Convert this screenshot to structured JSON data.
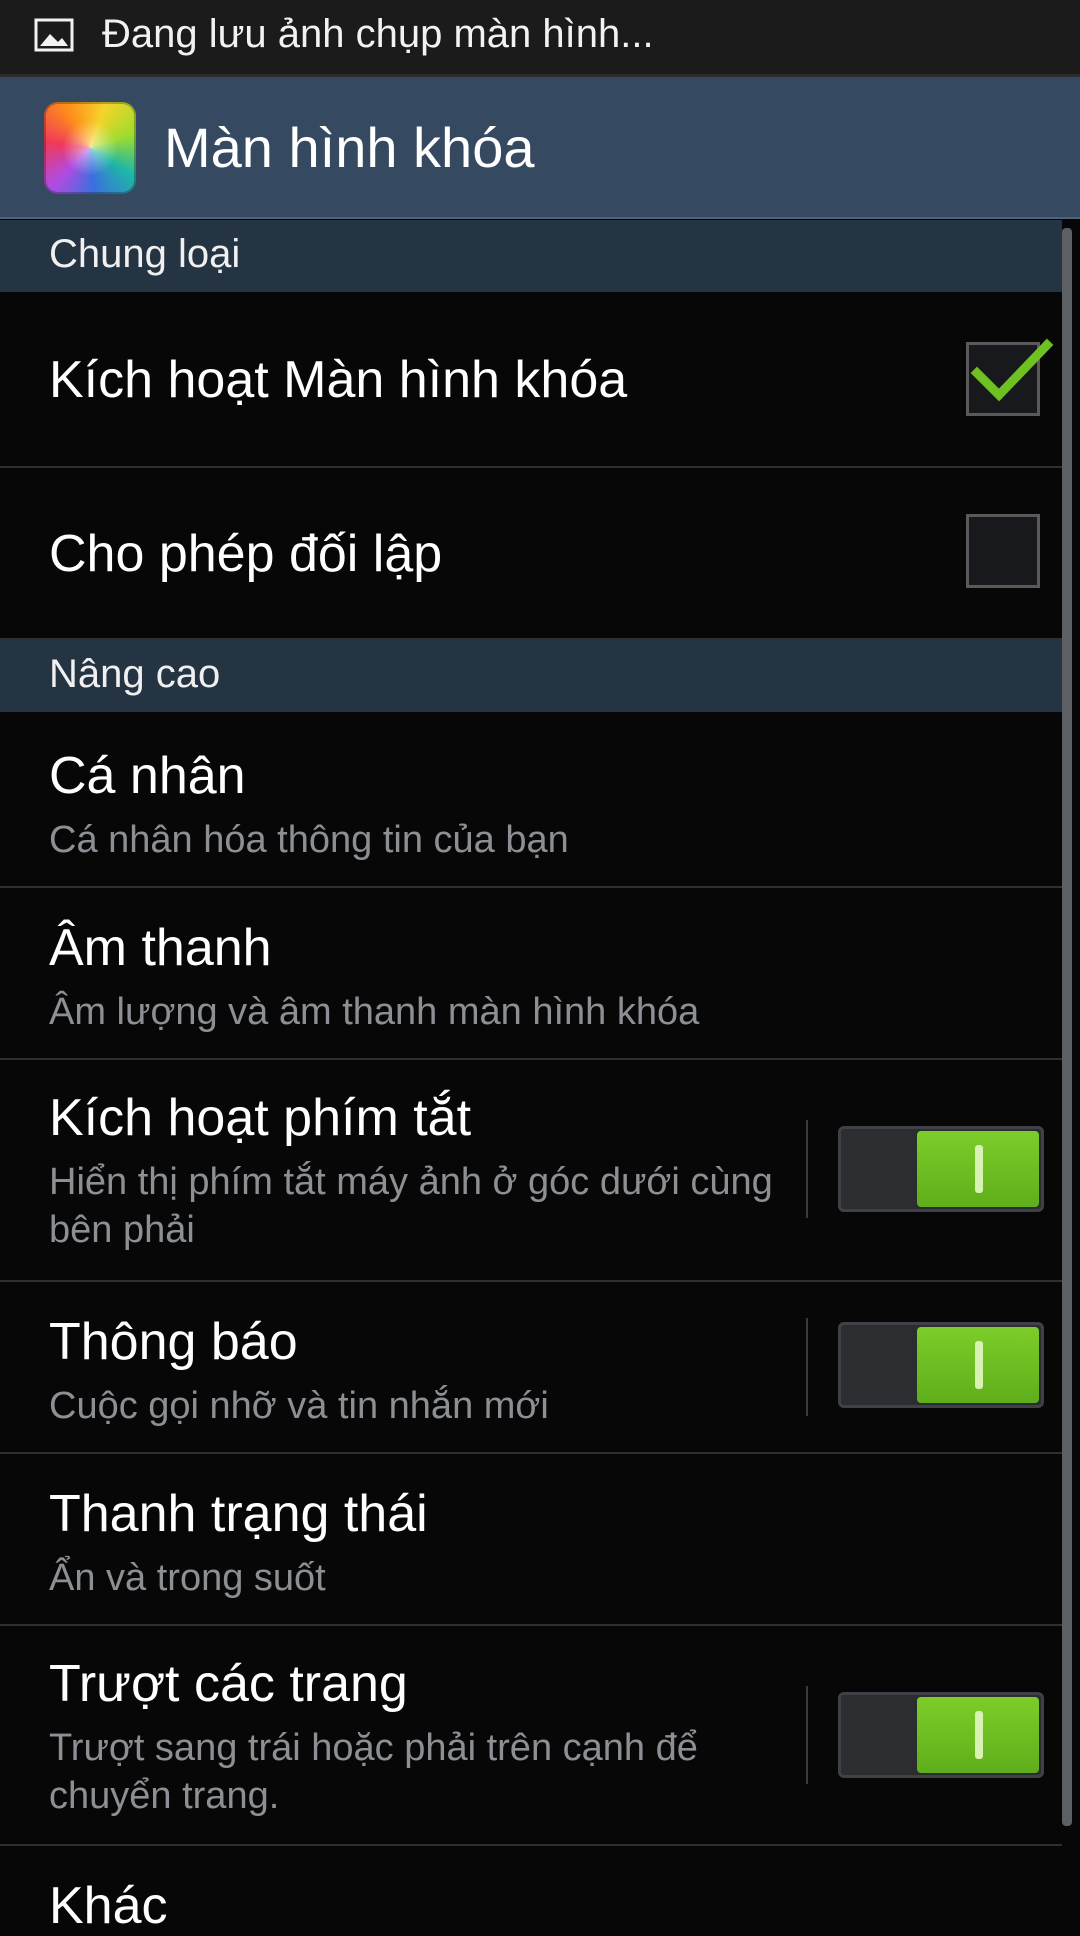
{
  "status_bar": {
    "icon": "image-icon",
    "text": "Đang lưu ảnh chụp màn hình..."
  },
  "action_bar": {
    "app_icon": "lock-screen-app-icon",
    "title": "Màn hình khóa"
  },
  "sections": {
    "general": {
      "label": "Chung loại"
    },
    "advanced": {
      "label": "Nâng cao"
    }
  },
  "items": {
    "enable_lock": {
      "title": "Kích hoạt Màn hình khóa",
      "checked": true
    },
    "allow_opposite": {
      "title": "Cho phép đối lập",
      "checked": false
    },
    "personal": {
      "title": "Cá nhân",
      "subtitle": "Cá nhân hóa thông tin của bạn"
    },
    "sound": {
      "title": "Âm thanh",
      "subtitle": "Âm lượng và âm thanh màn hình khóa"
    },
    "shortcut": {
      "title": "Kích hoạt phím tắt",
      "subtitle": "Hiển thị phím tắt máy ảnh ở góc dưới cùng bên phải",
      "on": true
    },
    "notifications": {
      "title": "Thông báo",
      "subtitle": "Cuộc gọi nhỡ và tin nhắn mới",
      "on": true
    },
    "status_bar": {
      "title": "Thanh trạng thái",
      "subtitle": "Ẩn và trong suốt"
    },
    "swipe_pages": {
      "title": "Trượt các trang",
      "subtitle": "Trượt sang trái hoặc phải trên cạnh để chuyển trang.",
      "on": true
    },
    "other": {
      "title": "Khác"
    }
  },
  "colors": {
    "accent_green": "#6fc023",
    "header_blue": "#354a61",
    "section_blue": "#243443"
  }
}
